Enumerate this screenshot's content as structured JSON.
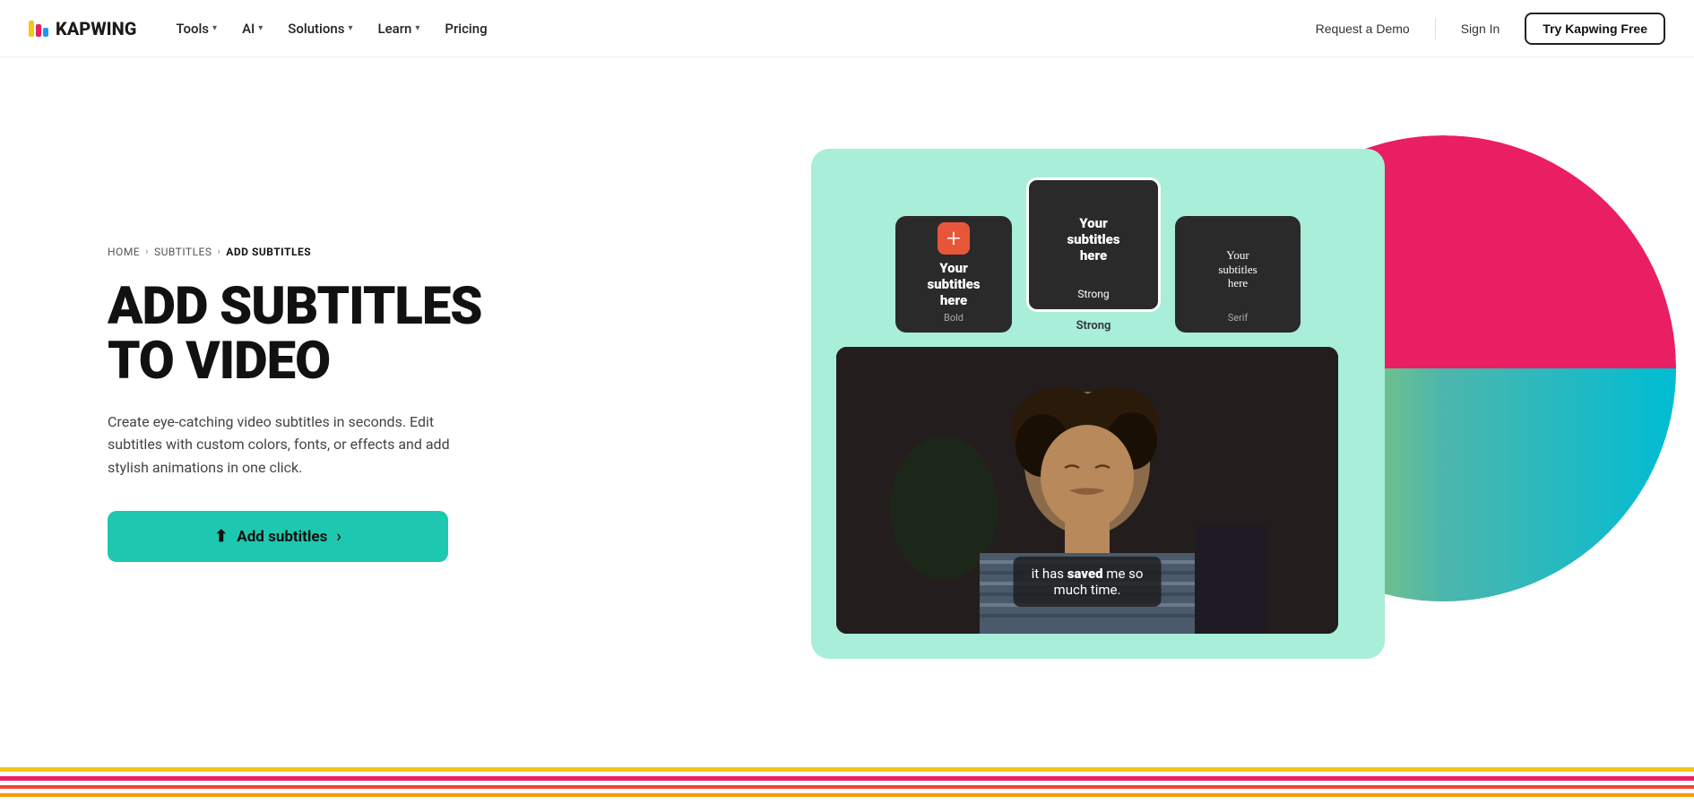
{
  "nav": {
    "logo_text": "KAPWING",
    "links": [
      {
        "label": "Tools",
        "has_dropdown": true
      },
      {
        "label": "AI",
        "has_dropdown": true
      },
      {
        "label": "Solutions",
        "has_dropdown": true
      },
      {
        "label": "Learn",
        "has_dropdown": true
      },
      {
        "label": "Pricing",
        "has_dropdown": false
      }
    ],
    "request_demo": "Request a Demo",
    "sign_in": "Sign In",
    "try_free": "Try Kapwing Free"
  },
  "breadcrumb": {
    "home": "HOME",
    "subtitles": "SUBTITLES",
    "current": "ADD SUBTITLES"
  },
  "hero": {
    "title_line1": "ADD SUBTITLES",
    "title_line2": "TO VIDEO",
    "description": "Create eye-catching video subtitles in seconds. Edit subtitles with custom colors, fonts, or effects and add stylish animations in one click.",
    "cta_label": "Add subtitles"
  },
  "editor": {
    "style_cards": [
      {
        "id": "bold",
        "text": "Your\nsubtitles\nhere",
        "label": "Bold",
        "style": "bold"
      },
      {
        "id": "strong",
        "text": "Your\nsubtitles\nhere",
        "label": "Strong",
        "style": "strong",
        "selected": true
      },
      {
        "id": "serif",
        "text": "Your\nsubtitles\nhere",
        "label": "Serif",
        "style": "serif"
      }
    ],
    "selected_label": "Strong",
    "video_subtitle": "it has saved me so much time."
  },
  "colors": {
    "teal": "#1ec8b0",
    "pink": "#e91e63",
    "red": "#f44336",
    "orange": "#ff9800",
    "yellow": "#ffeb3b",
    "green": "#4caf50",
    "blue": "#2196f3",
    "purple": "#9c27b0"
  },
  "bottom_lines": [
    "#f5c518",
    "#e91e63",
    "#f44336",
    "#ff9800"
  ]
}
